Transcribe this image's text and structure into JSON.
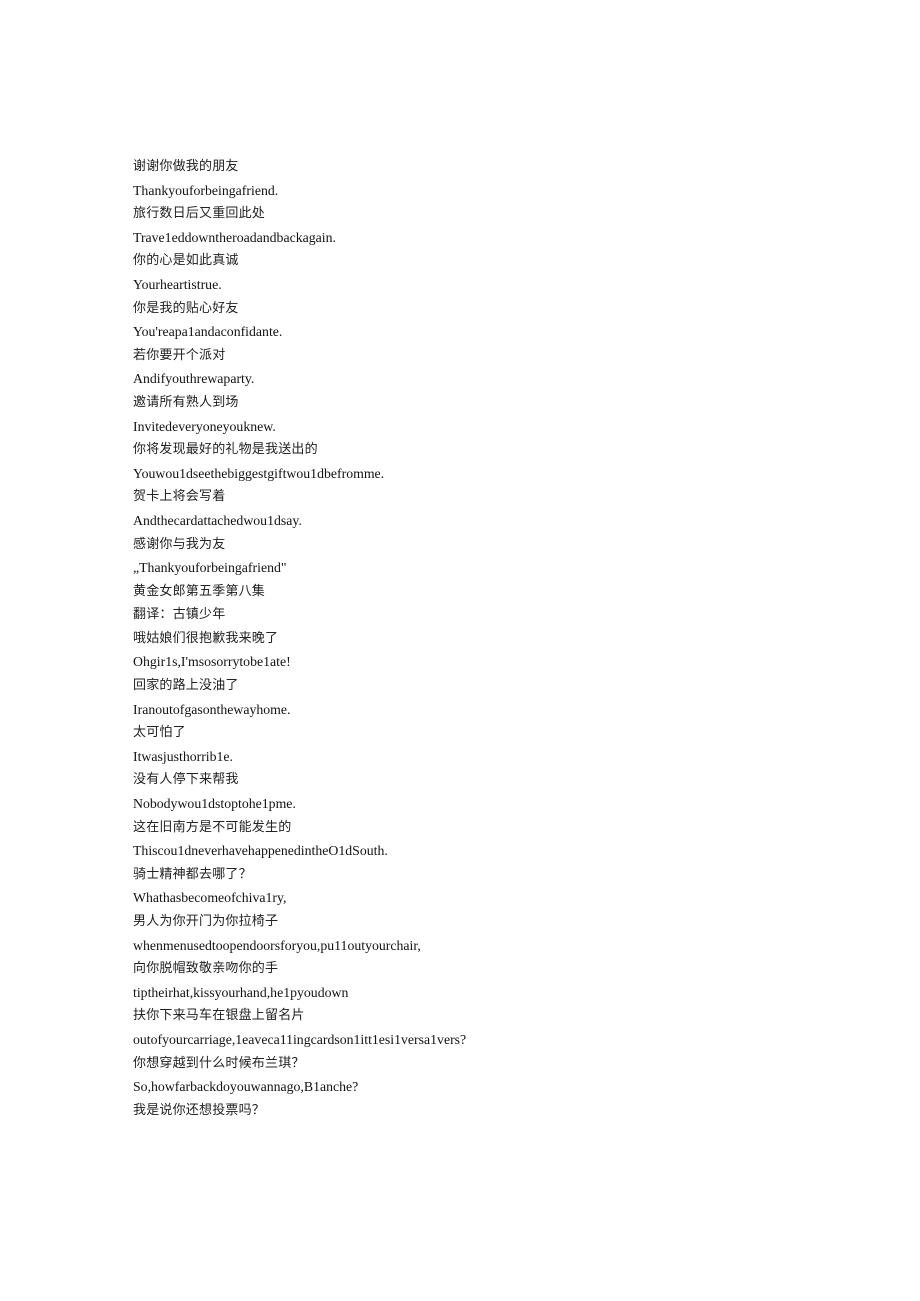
{
  "document": {
    "background_color": "#ffffff",
    "text_color": "#1a1a1a",
    "lines": [
      {
        "lang": "zh",
        "text": "谢谢你做我的朋友"
      },
      {
        "lang": "en",
        "text": "Thankyouforbeingafriend."
      },
      {
        "lang": "zh",
        "text": "旅行数日后又重回此处"
      },
      {
        "lang": "en",
        "text": "Trave1eddowntheroadandbackagain."
      },
      {
        "lang": "zh",
        "text": "你的心是如此真诚"
      },
      {
        "lang": "en",
        "text": "Yourheartistrue."
      },
      {
        "lang": "zh",
        "text": "你是我的贴心好友"
      },
      {
        "lang": "en",
        "text": "You'reapa1andaconfidante."
      },
      {
        "lang": "zh",
        "text": "若你要开个派对"
      },
      {
        "lang": "en",
        "text": "Andifyouthrewaparty."
      },
      {
        "lang": "zh",
        "text": "邀请所有熟人到场"
      },
      {
        "lang": "en",
        "text": "Invitedeveryoneyouknew."
      },
      {
        "lang": "zh",
        "text": "你将发现最好的礼物是我送出的"
      },
      {
        "lang": "en",
        "text": "Youwou1dseethebiggestgiftwou1dbefromme."
      },
      {
        "lang": "zh",
        "text": "贺卡上将会写着"
      },
      {
        "lang": "en",
        "text": "Andthecardattachedwou1dsay."
      },
      {
        "lang": "zh",
        "text": "感谢你与我为友"
      },
      {
        "lang": "en",
        "text": "„Thankyouforbeingafriend\""
      },
      {
        "lang": "zh",
        "text": "黄金女郎第五季第八集"
      },
      {
        "lang": "zh",
        "text": "翻译：古镇少年"
      },
      {
        "lang": "zh",
        "text": "哦姑娘们很抱歉我来晚了"
      },
      {
        "lang": "en",
        "text": "Ohgir1s,I'msosorrytobe1ate!"
      },
      {
        "lang": "zh",
        "text": "回家的路上没油了"
      },
      {
        "lang": "en",
        "text": "Iranoutofgasonthewayhome."
      },
      {
        "lang": "zh",
        "text": "太可怕了"
      },
      {
        "lang": "en",
        "text": "Itwasjusthorrib1e."
      },
      {
        "lang": "zh",
        "text": "没有人停下来帮我"
      },
      {
        "lang": "en",
        "text": "Nobodywou1dstoptohe1pme."
      },
      {
        "lang": "zh",
        "text": "这在旧南方是不可能发生的"
      },
      {
        "lang": "en",
        "text": "Thiscou1dneverhavehappenedintheO1dSouth."
      },
      {
        "lang": "zh",
        "text": "骑士精神都去哪了？"
      },
      {
        "lang": "en",
        "text": "Whathasbecomeofchiva1ry,"
      },
      {
        "lang": "zh",
        "text": "男人为你开门为你拉椅子"
      },
      {
        "lang": "en",
        "text": "whenmenusedtoopendoorsforyou,pu11outyourchair,"
      },
      {
        "lang": "zh",
        "text": "向你脱帽致敬亲吻你的手"
      },
      {
        "lang": "en",
        "text": "tiptheirhat,kissyourhand,he1pyoudown"
      },
      {
        "lang": "zh",
        "text": "扶你下来马车在银盘上留名片"
      },
      {
        "lang": "en",
        "text": "outofyourcarriage,1eaveca11ingcardson1itt1esi1versa1vers?"
      },
      {
        "lang": "zh",
        "text": "你想穿越到什么时候布兰琪？"
      },
      {
        "lang": "en",
        "text": "So,howfarbackdoyouwannago,B1anche?"
      },
      {
        "lang": "zh",
        "text": "我是说你还想投票吗？"
      }
    ]
  }
}
